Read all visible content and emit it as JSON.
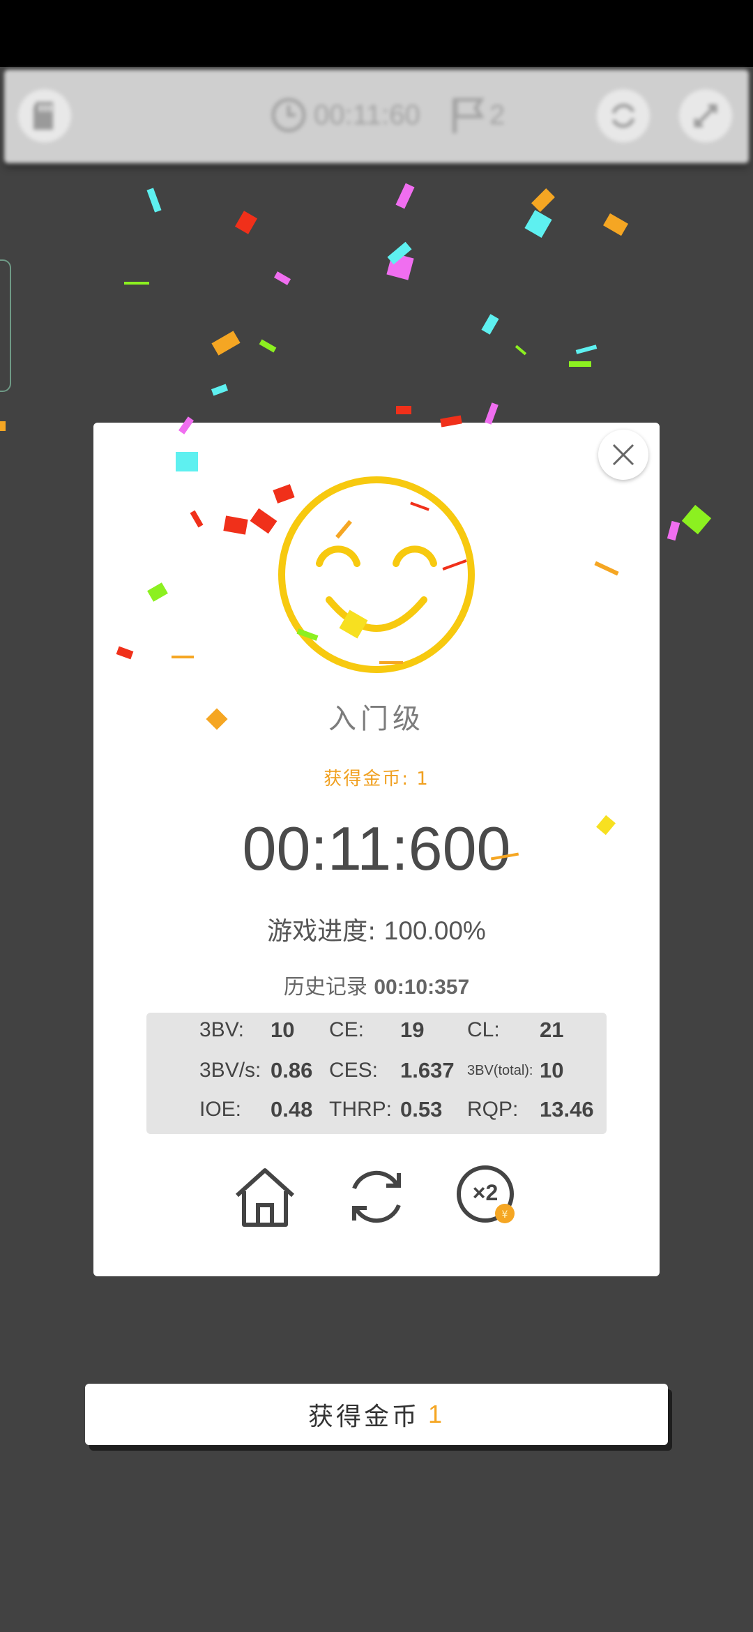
{
  "toolbar": {
    "timer": "00:11:60",
    "flags": "2"
  },
  "modal": {
    "level": "入门级",
    "coins_earned": "获得金币: 1",
    "time": "00:11:600",
    "progress_label": "游戏进度:",
    "progress_value": "100.00%",
    "record_label": "历史记录",
    "record_value": "00:10:357"
  },
  "stats": {
    "rows": [
      [
        {
          "label": "3BV:",
          "value": "10"
        },
        {
          "label": "CE:",
          "value": "19"
        },
        {
          "label": "CL:",
          "value": "21"
        }
      ],
      [
        {
          "label": "3BV/s:",
          "value": "0.86"
        },
        {
          "label": "CES:",
          "value": "1.637"
        },
        {
          "label": "3BV(total):",
          "value": "10"
        }
      ],
      [
        {
          "label": "IOE:",
          "value": "0.48"
        },
        {
          "label": "THRP:",
          "value": "0.53"
        },
        {
          "label": "RQP:",
          "value": "13.46"
        }
      ]
    ]
  },
  "actions": {
    "double_badge": "×2"
  },
  "coin_bar": {
    "label": "获得金币",
    "amount": "1"
  },
  "colors": {
    "background": "#424242",
    "accent_gold": "#f5a623",
    "smiley": "#f7c90f"
  }
}
